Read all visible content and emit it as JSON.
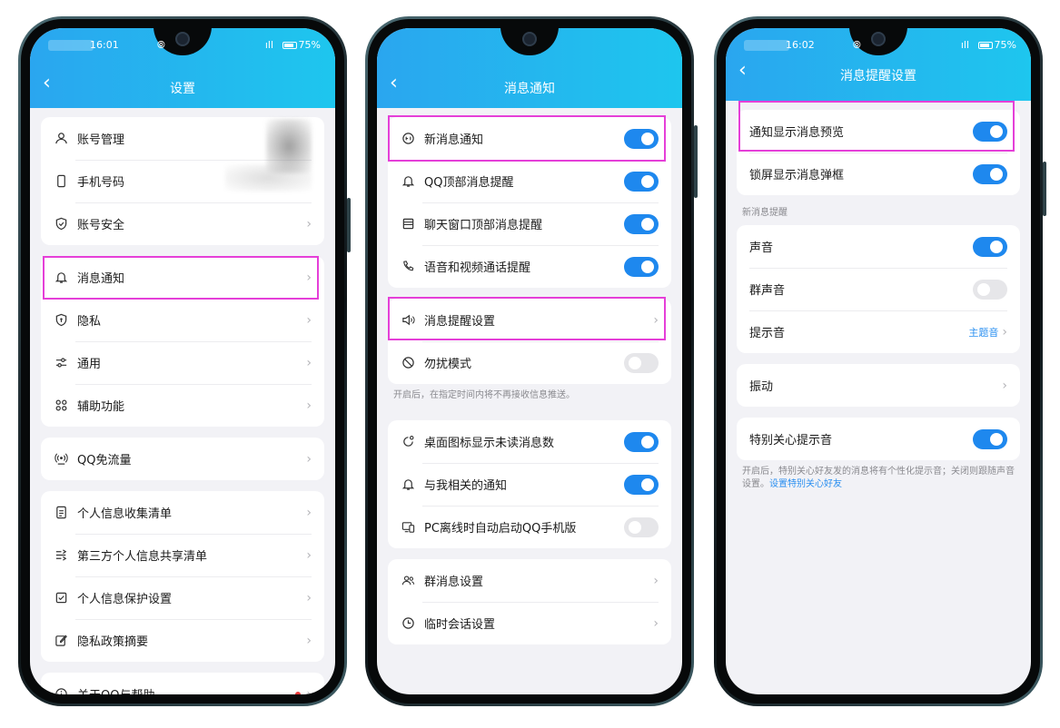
{
  "phone1": {
    "status": {
      "time": "16:01",
      "battery": "75%"
    },
    "title": "设置",
    "groups": [
      [
        {
          "label": "账号管理"
        },
        {
          "label": "手机号码"
        },
        {
          "label": "账号安全"
        }
      ],
      [
        {
          "label": "消息通知"
        },
        {
          "label": "隐私"
        },
        {
          "label": "通用"
        },
        {
          "label": "辅助功能"
        }
      ],
      [
        {
          "label": "QQ免流量"
        }
      ],
      [
        {
          "label": "个人信息收集清单"
        },
        {
          "label": "第三方个人信息共享清单"
        },
        {
          "label": "个人信息保护设置"
        },
        {
          "label": "隐私政策摘要"
        }
      ],
      [
        {
          "label": "关于QQ与帮助"
        }
      ]
    ]
  },
  "phone2": {
    "title": "消息通知",
    "groups": [
      [
        {
          "label": "新消息通知",
          "on": true
        },
        {
          "label": "QQ顶部消息提醒",
          "on": true
        },
        {
          "label": "聊天窗口顶部消息提醒",
          "on": true
        },
        {
          "label": "语音和视频通话提醒",
          "on": true
        }
      ],
      [
        {
          "label": "消息提醒设置"
        },
        {
          "label": "勿扰模式",
          "on": false
        }
      ],
      [
        {
          "label": "桌面图标显示未读消息数",
          "on": true
        },
        {
          "label": "与我相关的通知",
          "on": true
        },
        {
          "label": "PC离线时自动启动QQ手机版",
          "on": false
        }
      ],
      [
        {
          "label": "群消息设置"
        },
        {
          "label": "临时会话设置"
        }
      ]
    ],
    "dnd_note": "开启后，在指定时间内将不再接收信息推送。"
  },
  "phone3": {
    "status": {
      "time": "16:02",
      "battery": "75%"
    },
    "title": "消息提醒设置",
    "groups": [
      [
        {
          "label": "通知显示消息预览",
          "on": true
        },
        {
          "label": "锁屏显示消息弹框",
          "on": true
        }
      ],
      [
        {
          "label": "声音",
          "on": true
        },
        {
          "label": "群声音",
          "on": false
        },
        {
          "label": "提示音",
          "value": "主题音"
        }
      ],
      [
        {
          "label": "振动"
        }
      ],
      [
        {
          "label": "特别关心提示音",
          "on": true
        }
      ]
    ],
    "section_new": "新消息提醒",
    "note": "开启后，特别关心好友发的消息将有个性化提示音；关闭则跟随声音设置。",
    "note_link": "设置特别关心好友"
  },
  "colors": {
    "header_start": "#2aa6ef",
    "header_end": "#1ec6ee",
    "toggle_on": "#1e88ee",
    "highlight": "#e53fd8"
  }
}
